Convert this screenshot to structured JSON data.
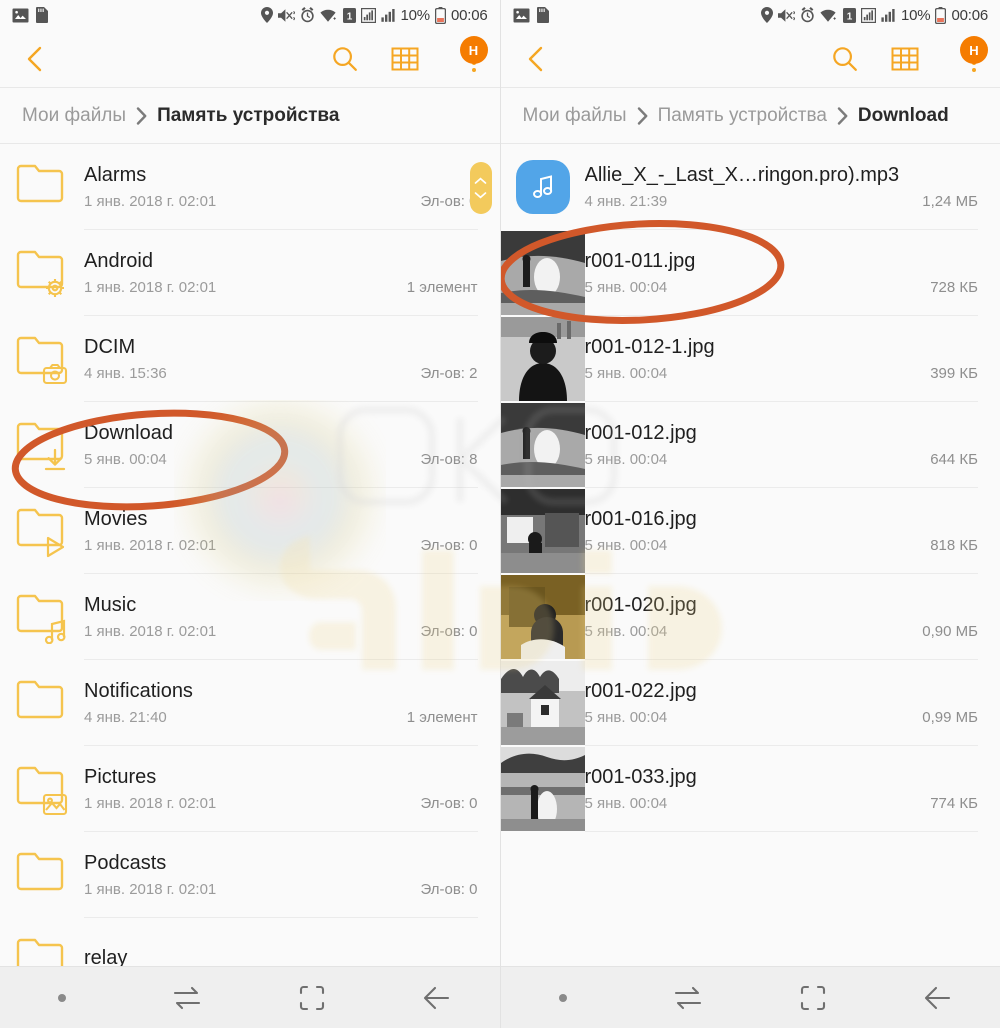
{
  "colors": {
    "accent": "#F5A623",
    "folder": "#F5C44E",
    "badge": "#F57C00",
    "annotation": "#D1582A",
    "music_tile": "#52A5E8",
    "scrollbar": "#F3CA5C"
  },
  "status_bar": {
    "time": "00:06",
    "battery_percent": "10%",
    "icons": [
      "image-icon",
      "sd-card-icon",
      "location-icon",
      "mute-vibrate-icon",
      "alarm-icon",
      "wifi-icon",
      "sim-1-icon",
      "signal-icon",
      "signal-2-icon",
      "battery-icon"
    ]
  },
  "action_bar": {
    "back_label": "back-icon",
    "search_label": "search-icon",
    "grid_label": "grid-view-icon",
    "more_label": "more-options-icon",
    "avatar_letter": "H"
  },
  "left": {
    "breadcrumb": [
      {
        "label": "Мои файлы",
        "active": false
      },
      {
        "label": "Память устройства",
        "active": true
      }
    ],
    "rows": [
      {
        "name": "Alarms",
        "date": "1 янв. 2018 г. 02:01",
        "info": "Эл-ов: 0",
        "icon": "folder"
      },
      {
        "name": "Android",
        "date": "1 янв. 2018 г. 02:01",
        "info": "1 элемент",
        "icon": "folder-gear"
      },
      {
        "name": "DCIM",
        "date": "4 янв. 15:36",
        "info": "Эл-ов: 2",
        "icon": "folder-camera"
      },
      {
        "name": "Download",
        "date": "5 янв. 00:04",
        "info": "Эл-ов: 8",
        "icon": "folder-download"
      },
      {
        "name": "Movies",
        "date": "1 янв. 2018 г. 02:01",
        "info": "Эл-ов: 0",
        "icon": "folder-play"
      },
      {
        "name": "Music",
        "date": "1 янв. 2018 г. 02:01",
        "info": "Эл-ов: 0",
        "icon": "folder-music"
      },
      {
        "name": "Notifications",
        "date": "4 янв. 21:40",
        "info": "1 элемент",
        "icon": "folder"
      },
      {
        "name": "Pictures",
        "date": "1 янв. 2018 г. 02:01",
        "info": "Эл-ов: 0",
        "icon": "folder-image"
      },
      {
        "name": "Podcasts",
        "date": "1 янв. 2018 г. 02:01",
        "info": "Эл-ов: 0",
        "icon": "folder"
      },
      {
        "name": "relay",
        "date": "",
        "info": "",
        "icon": "folder"
      }
    ]
  },
  "right": {
    "breadcrumb": [
      {
        "label": "Мои файлы",
        "active": false
      },
      {
        "label": "Память устройства",
        "active": false
      },
      {
        "label": "Download",
        "active": true
      }
    ],
    "rows": [
      {
        "name": "Allie_X_-_Last_X…ringon.pro).mp3",
        "date": "4 янв. 21:39",
        "info": "1,24 МБ",
        "icon": "music-file"
      },
      {
        "name": "r001-011.jpg",
        "date": "5 янв. 00:04",
        "info": "728 КБ",
        "icon": "photo-thumb-1"
      },
      {
        "name": "r001-012-1.jpg",
        "date": "5 янв. 00:04",
        "info": "399 КБ",
        "icon": "photo-thumb-2"
      },
      {
        "name": "r001-012.jpg",
        "date": "5 янв. 00:04",
        "info": "644 КБ",
        "icon": "photo-thumb-3"
      },
      {
        "name": "r001-016.jpg",
        "date": "5 янв. 00:04",
        "info": "818 КБ",
        "icon": "photo-thumb-4"
      },
      {
        "name": "r001-020.jpg",
        "date": "5 янв. 00:04",
        "info": "0,90 МБ",
        "icon": "photo-thumb-5"
      },
      {
        "name": "r001-022.jpg",
        "date": "5 янв. 00:04",
        "info": "0,99 МБ",
        "icon": "photo-thumb-6"
      },
      {
        "name": "r001-033.jpg",
        "date": "5 янв. 00:04",
        "info": "774 КБ",
        "icon": "photo-thumb-7"
      }
    ]
  },
  "nav_bar": {
    "buttons": [
      "dot-indicator",
      "recents-icon",
      "home-icon",
      "back-icon"
    ]
  },
  "annotations": [
    {
      "target": "Download",
      "shape": "ellipse"
    },
    {
      "target": "r001-011.jpg",
      "shape": "ellipse"
    }
  ],
  "watermark": {
    "text": "android"
  }
}
